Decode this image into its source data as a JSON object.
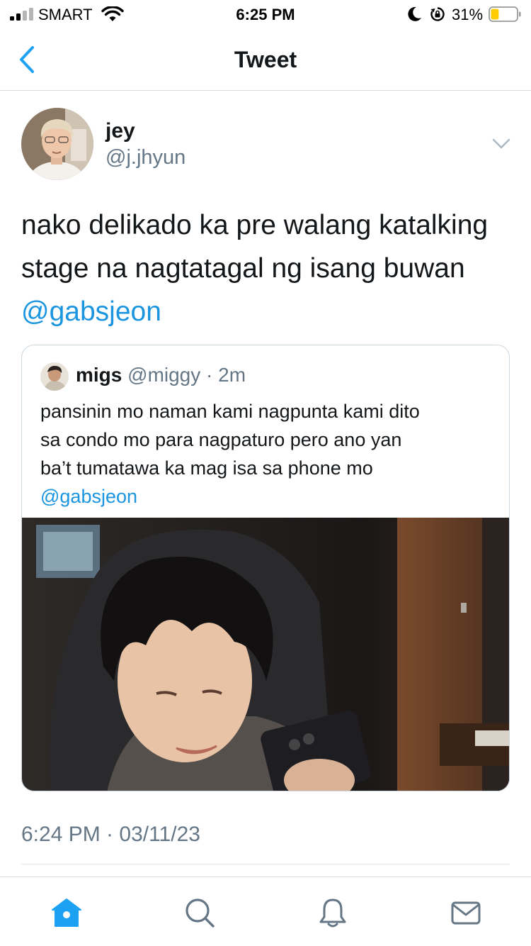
{
  "status_bar": {
    "carrier": "SMART",
    "time": "6:25 PM",
    "battery_percent": "31%",
    "battery_level": 0.31,
    "battery_color": "#ffcc00",
    "icons": [
      "signal-icon",
      "wifi-icon",
      "moon-icon",
      "rotation-lock-icon",
      "battery-icon"
    ]
  },
  "nav": {
    "back_icon": "chevron-left-icon",
    "title": "Tweet"
  },
  "tweet": {
    "author": {
      "name": "jey",
      "handle": "@j.jhyun"
    },
    "menu_icon": "chevron-down-icon",
    "text_lines": [
      "nako delikado ka pre walang katalking",
      "stage na nagtatagal ng isang buwan"
    ],
    "mention": "@gabsjeon",
    "timestamp": "6:24 PM · 03/11/23"
  },
  "quoted_tweet": {
    "name": "migs",
    "handle": "@miggy",
    "time": "· 2m",
    "text_lines": [
      "pansinin mo naman kami nagpunta kami dito",
      "sa condo mo para nagpaturo pero ano yan",
      "ba’t tumatawa ka mag isa sa phone mo"
    ],
    "mention": "@gabsjeon"
  },
  "tabbar": {
    "items": [
      {
        "icon": "home-icon",
        "active": true
      },
      {
        "icon": "search-icon",
        "active": false
      },
      {
        "icon": "bell-icon",
        "active": false
      },
      {
        "icon": "mail-icon",
        "active": false
      }
    ]
  },
  "colors": {
    "accent": "#1da1f2",
    "link": "#1b95e0",
    "secondary_text": "#657786",
    "border": "#ccd6dd"
  }
}
